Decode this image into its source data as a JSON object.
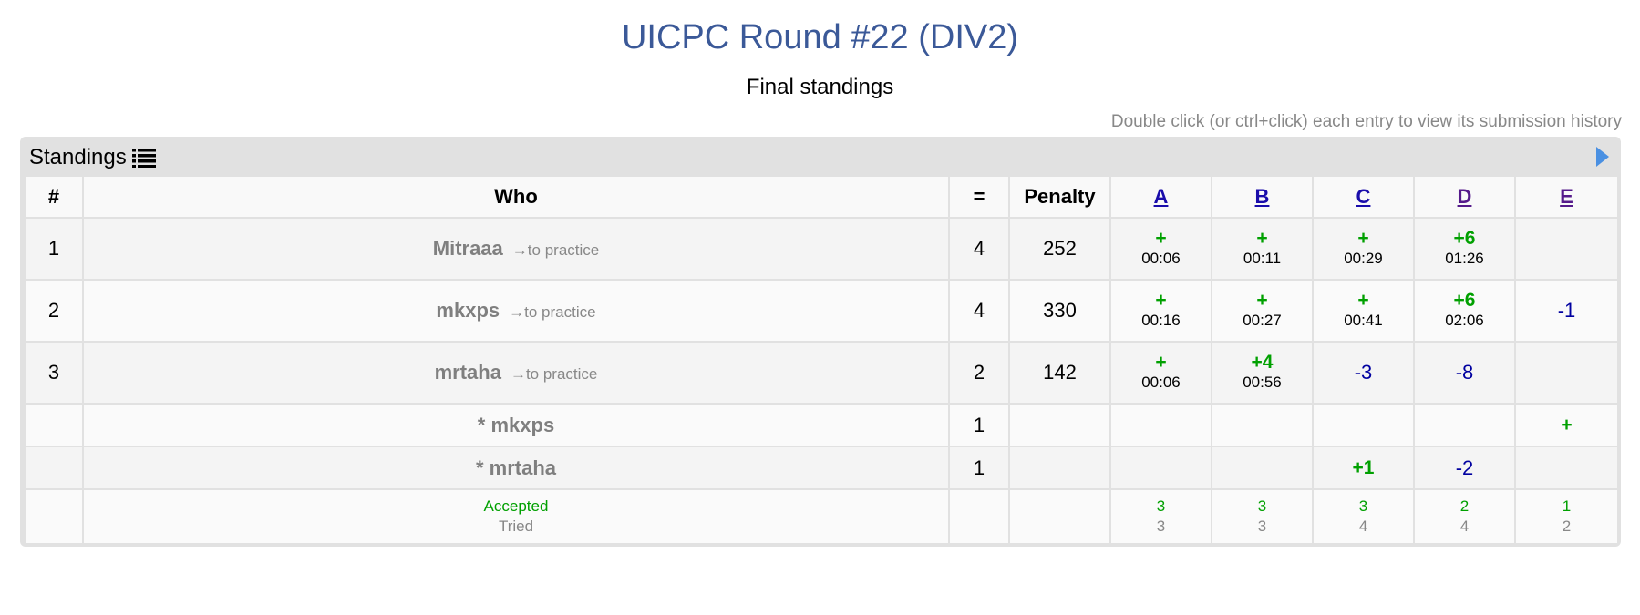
{
  "header": {
    "title": "UICPC Round #22 (DIV2)",
    "subtitle": "Final standings",
    "hint": "Double click (or ctrl+click) each entry to view its submission history"
  },
  "panel": {
    "title": "Standings",
    "icons": {
      "list": "list-icon",
      "next": "play-arrow-icon"
    }
  },
  "columns": {
    "rank": "#",
    "who": "Who",
    "solved": "=",
    "penalty": "Penalty",
    "problems": [
      "A",
      "B",
      "C",
      "D",
      "E"
    ]
  },
  "practice_label": "→to practice",
  "rows": [
    {
      "rank": "1",
      "name": "Mitraaa",
      "solved": "4",
      "penalty": "252",
      "cells": [
        {
          "result": "+",
          "time": "00:06"
        },
        {
          "result": "+",
          "time": "00:11"
        },
        {
          "result": "+",
          "time": "00:29"
        },
        {
          "result": "+6",
          "time": "01:26"
        },
        {
          "result": "",
          "time": ""
        }
      ]
    },
    {
      "rank": "2",
      "name": "mkxps",
      "solved": "4",
      "penalty": "330",
      "cells": [
        {
          "result": "+",
          "time": "00:16"
        },
        {
          "result": "+",
          "time": "00:27"
        },
        {
          "result": "+",
          "time": "00:41"
        },
        {
          "result": "+6",
          "time": "02:06"
        },
        {
          "result": "-1",
          "time": ""
        }
      ]
    },
    {
      "rank": "3",
      "name": "mrtaha",
      "solved": "2",
      "penalty": "142",
      "cells": [
        {
          "result": "+",
          "time": "00:06"
        },
        {
          "result": "+4",
          "time": "00:56"
        },
        {
          "result": "-3",
          "time": ""
        },
        {
          "result": "-8",
          "time": ""
        },
        {
          "result": "",
          "time": ""
        }
      ]
    }
  ],
  "unofficial_rows": [
    {
      "name": "* mkxps",
      "solved": "1",
      "cells": [
        "",
        "",
        "",
        "",
        "+"
      ]
    },
    {
      "name": "* mrtaha",
      "solved": "1",
      "cells": [
        "",
        "",
        "+1",
        "-2",
        ""
      ]
    }
  ],
  "stats": {
    "accepted_label": "Accepted",
    "tried_label": "Tried",
    "accepted": [
      "3",
      "3",
      "3",
      "2",
      "1"
    ],
    "tried": [
      "3",
      "3",
      "4",
      "4",
      "2"
    ]
  },
  "colors": {
    "title": "#3b5998",
    "accepted": "#00a000",
    "rejected": "#0000a0",
    "panel_bg": "#e1e1e1"
  }
}
